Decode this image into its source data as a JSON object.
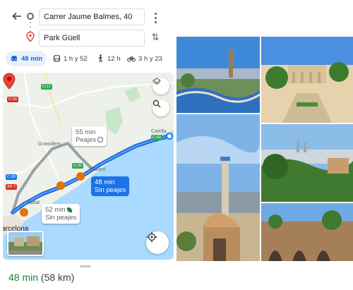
{
  "directions": {
    "origin": "Carrer Jaume Balmes, 40",
    "destination": "Park Güell"
  },
  "modes": [
    {
      "name": "car",
      "label": "48 min",
      "active": true
    },
    {
      "name": "transit",
      "label": "1 h y 52"
    },
    {
      "name": "walk",
      "label": "12 h"
    },
    {
      "name": "bike",
      "label": "3 h y 23"
    }
  ],
  "map": {
    "road_labels": [
      "C-17",
      "C-59",
      "C-32",
      "C-32",
      "C-58",
      "AP-7"
    ],
    "places": [
      "Granollers",
      "Mataró",
      "Calella",
      "Badal",
      "arcelona"
    ],
    "callouts": {
      "alt_toll": {
        "time": "55 min",
        "note": "Peajes"
      },
      "best": {
        "time": "48 min",
        "note": "Sin peajes"
      },
      "alt_free": {
        "time": "52 min",
        "note": "Sin peajes"
      }
    }
  },
  "summary": {
    "duration": "48 min",
    "distance": "(58 km)"
  },
  "colors": {
    "route_primary": "#1a73e8",
    "route_alt": "#9aa0a6",
    "duration_green": "#188038",
    "sea": "#aadaff"
  }
}
